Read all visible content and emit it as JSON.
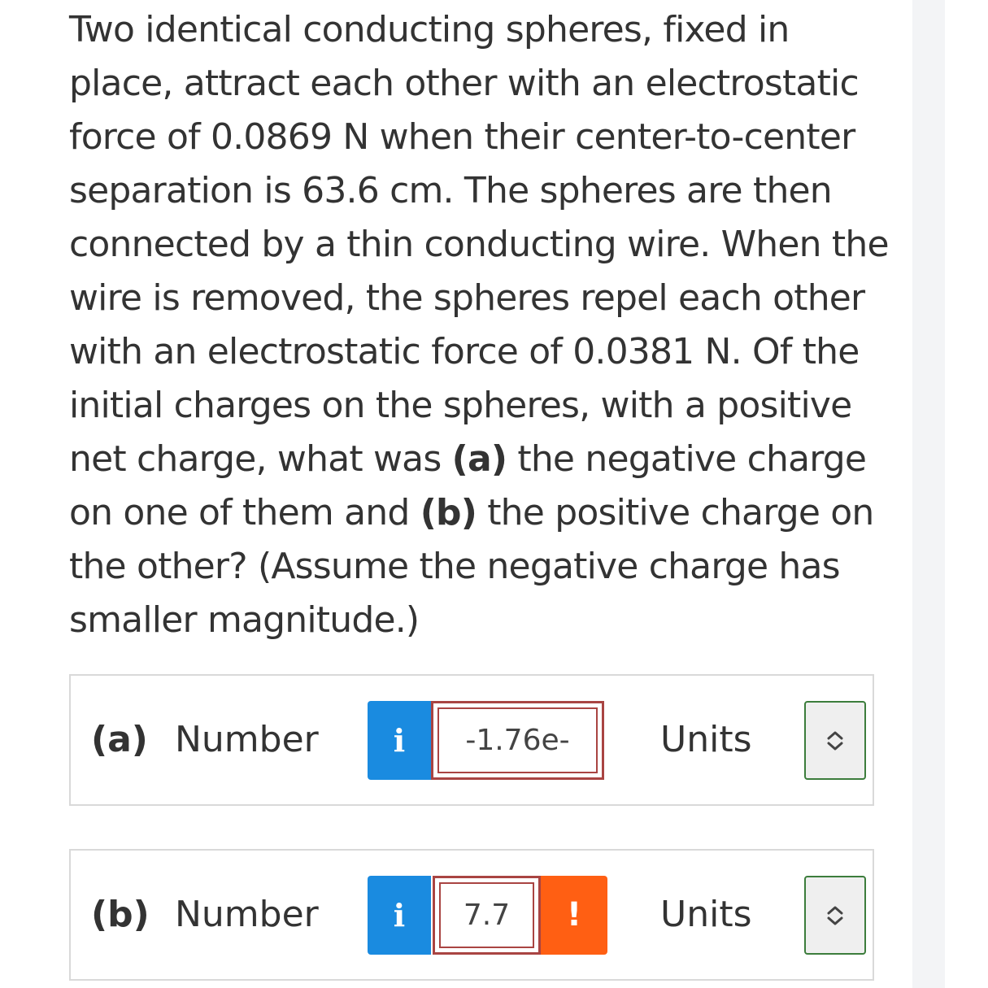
{
  "question": {
    "text_1": "Two identical conducting spheres, fixed in place, attract each other with an electrostatic force of 0.0869 N when their center-to-center separation is 63.6 cm. The spheres are then connected by a thin conducting wire. When the wire is removed, the spheres repel each other with an electrostatic force of 0.0381 N. Of the initial charges on the spheres, with a positive net charge, what was ",
    "bold_a": "(a)",
    "text_2": " the negative charge on one of them and ",
    "bold_b": "(b)",
    "text_3": " the positive charge on the other? (Assume the negative charge has smaller magnitude.)"
  },
  "answers": [
    {
      "part": "(a)",
      "number_label": "Number",
      "info_label": "i",
      "value": "-1.76e-",
      "units_label": "Units",
      "units_icon": "chevron-up-down-icon"
    },
    {
      "part": "(b)",
      "number_label": "Number",
      "info_label": "i",
      "value": "7.7",
      "warning_label": "!",
      "units_label": "Units",
      "units_icon": "chevron-up-down-icon"
    }
  ],
  "colors": {
    "info_blue": "#1a8be0",
    "error_red": "#a94442",
    "warning_orange": "#ff5f13",
    "select_green": "#3c7d3c"
  }
}
